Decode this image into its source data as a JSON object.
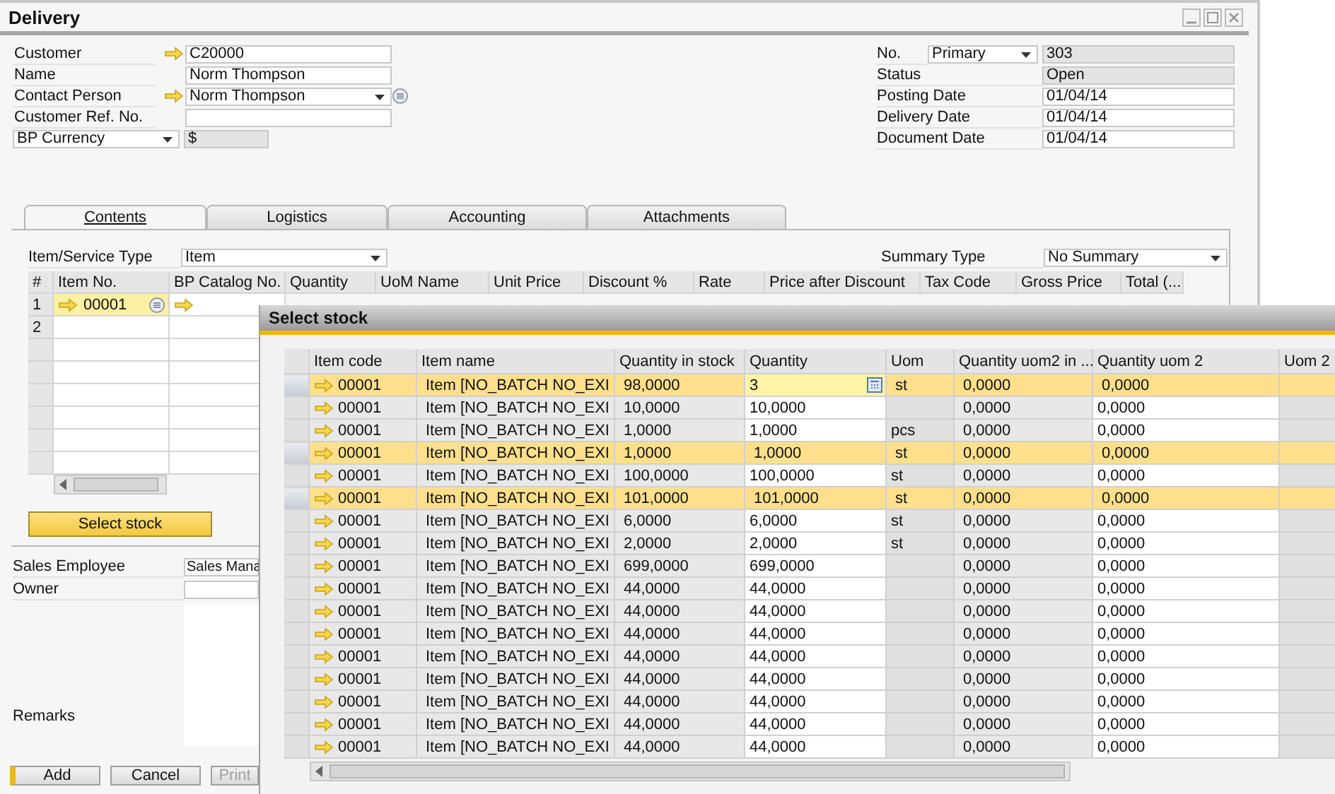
{
  "window": {
    "title": "Delivery"
  },
  "header_left": [
    {
      "label": "Customer",
      "kind": "link",
      "value": "C20000"
    },
    {
      "label": "Name",
      "kind": "text",
      "value": "Norm Thompson"
    },
    {
      "label": "Contact Person",
      "kind": "link_dropdown",
      "value": "Norm Thompson"
    },
    {
      "label": "Customer Ref. No.",
      "kind": "text"
    }
  ],
  "currency": {
    "label": "BP Currency",
    "value": "$"
  },
  "header_right": [
    {
      "label": "No.",
      "kind": "series",
      "series": "Primary",
      "value": "303"
    },
    {
      "label": "Status",
      "kind": "readonly",
      "value": "Open"
    },
    {
      "label": "Posting Date",
      "kind": "text",
      "value": "01/04/14"
    },
    {
      "label": "Delivery Date",
      "kind": "text",
      "value": "01/04/14"
    },
    {
      "label": "Document Date",
      "kind": "text",
      "value": "01/04/14"
    }
  ],
  "tabs": [
    {
      "label": "Contents",
      "selected": true
    },
    {
      "label": "Logistics",
      "selected": false
    },
    {
      "label": "Accounting",
      "selected": false
    },
    {
      "label": "Attachments",
      "selected": false
    }
  ],
  "item_type": {
    "label": "Item/Service Type",
    "value": "Item"
  },
  "summary_type": {
    "label": "Summary Type",
    "value": "No Summary"
  },
  "grid": {
    "columns": [
      "#",
      "Item No.",
      "BP Catalog No.",
      "Quantity",
      "UoM Name",
      "Unit Price",
      "Discount %",
      "Rate",
      "Price after Discount",
      "Tax Code",
      "Gross Price",
      "Total (..."
    ],
    "rows": [
      {
        "number": "1",
        "item_no": "00001",
        "selected": true
      },
      {
        "number": "2",
        "selected": false
      }
    ]
  },
  "select_stock_button": "Select stock",
  "footer_fields": [
    {
      "label": "Sales Employee",
      "value": "Sales Mana"
    },
    {
      "label": "Owner"
    },
    {
      "label": "Remarks"
    }
  ],
  "buttons": [
    {
      "label": "Add",
      "disabled": false
    },
    {
      "label": "Cancel",
      "disabled": false
    },
    {
      "label": "Print",
      "disabled": true
    }
  ],
  "dialog": {
    "title": "Select stock",
    "columns": [
      "Item code",
      "Item name",
      "Quantity in stock",
      "Quantity",
      "Uom",
      "Quantity uom2 in ...",
      "Quantity uom 2",
      "Uom 2"
    ],
    "rows": [
      {
        "code": "00001",
        "name": "Item [NO_BATCH NO_EXI",
        "in_stock": "98,0000",
        "quantity": "3",
        "uom": "st",
        "uom2_in": "0,0000",
        "uom2": "0,0000",
        "selected": true,
        "editing": true
      },
      {
        "code": "00001",
        "name": "Item [NO_BATCH NO_EXI",
        "in_stock": "10,0000",
        "quantity": "10,0000",
        "uom2_in": "0,0000",
        "uom2": "0,0000",
        "selected": false,
        "editing": false
      },
      {
        "code": "00001",
        "name": "Item [NO_BATCH NO_EXI",
        "in_stock": "1,0000",
        "quantity": "1,0000",
        "uom": "pcs",
        "uom2_in": "0,0000",
        "uom2": "0,0000",
        "selected": false,
        "editing": false
      },
      {
        "code": "00001",
        "name": "Item [NO_BATCH NO_EXI",
        "in_stock": "1,0000",
        "quantity": "1,0000",
        "uom": "st",
        "uom2_in": "0,0000",
        "uom2": "0,0000",
        "selected": true,
        "editing": false
      },
      {
        "code": "00001",
        "name": "Item [NO_BATCH NO_EXI",
        "in_stock": "100,0000",
        "quantity": "100,0000",
        "uom": "st",
        "uom2_in": "0,0000",
        "uom2": "0,0000",
        "selected": false,
        "editing": false
      },
      {
        "code": "00001",
        "name": "Item [NO_BATCH NO_EXI",
        "in_stock": "101,0000",
        "quantity": "101,0000",
        "uom": "st",
        "uom2_in": "0,0000",
        "uom2": "0,0000",
        "selected": true,
        "editing": false
      },
      {
        "code": "00001",
        "name": "Item [NO_BATCH NO_EXI",
        "in_stock": "6,0000",
        "quantity": "6,0000",
        "uom": "st",
        "uom2_in": "0,0000",
        "uom2": "0,0000",
        "selected": false,
        "editing": false
      },
      {
        "code": "00001",
        "name": "Item [NO_BATCH NO_EXI",
        "in_stock": "2,0000",
        "quantity": "2,0000",
        "uom": "st",
        "uom2_in": "0,0000",
        "uom2": "0,0000",
        "selected": false,
        "editing": false
      },
      {
        "code": "00001",
        "name": "Item [NO_BATCH NO_EXI",
        "in_stock": "699,0000",
        "quantity": "699,0000",
        "uom2_in": "0,0000",
        "uom2": "0,0000",
        "selected": false,
        "editing": false
      },
      {
        "code": "00001",
        "name": "Item [NO_BATCH NO_EXI",
        "in_stock": "44,0000",
        "quantity": "44,0000",
        "uom2_in": "0,0000",
        "uom2": "0,0000",
        "selected": false,
        "editing": false
      },
      {
        "code": "00001",
        "name": "Item [NO_BATCH NO_EXI",
        "in_stock": "44,0000",
        "quantity": "44,0000",
        "uom2_in": "0,0000",
        "uom2": "0,0000",
        "selected": false,
        "editing": false
      },
      {
        "code": "00001",
        "name": "Item [NO_BATCH NO_EXI",
        "in_stock": "44,0000",
        "quantity": "44,0000",
        "uom2_in": "0,0000",
        "uom2": "0,0000",
        "selected": false,
        "editing": false
      },
      {
        "code": "00001",
        "name": "Item [NO_BATCH NO_EXI",
        "in_stock": "44,0000",
        "quantity": "44,0000",
        "uom2_in": "0,0000",
        "uom2": "0,0000",
        "selected": false,
        "editing": false
      },
      {
        "code": "00001",
        "name": "Item [NO_BATCH NO_EXI",
        "in_stock": "44,0000",
        "quantity": "44,0000",
        "uom2_in": "0,0000",
        "uom2": "0,0000",
        "selected": false,
        "editing": false
      },
      {
        "code": "00001",
        "name": "Item [NO_BATCH NO_EXI",
        "in_stock": "44,0000",
        "quantity": "44,0000",
        "uom2_in": "0,0000",
        "uom2": "0,0000",
        "selected": false,
        "editing": false
      },
      {
        "code": "00001",
        "name": "Item [NO_BATCH NO_EXI",
        "in_stock": "44,0000",
        "quantity": "44,0000",
        "uom2_in": "0,0000",
        "uom2": "0,0000",
        "selected": false,
        "editing": false
      },
      {
        "code": "00001",
        "name": "Item [NO_BATCH NO_EXI",
        "in_stock": "44,0000",
        "quantity": "44,0000",
        "uom2_in": "0,0000",
        "uom2": "0,0000",
        "selected": false,
        "editing": false
      }
    ]
  }
}
